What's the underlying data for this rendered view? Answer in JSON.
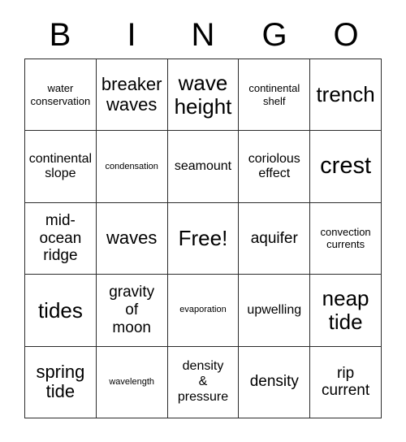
{
  "card": {
    "title": "BINGO",
    "header_letters": [
      "B",
      "I",
      "N",
      "G",
      "O"
    ],
    "columns": 5,
    "rows": 5,
    "free_space": "Free!",
    "free_space_position": {
      "row": 3,
      "column": 3
    },
    "colors": {
      "background": "#ffffff",
      "cell_background": "#ffffff",
      "border": "#2b2b2b",
      "text": "#000000"
    },
    "cells": [
      [
        {
          "text": "water\nconservation",
          "size": "sz-sm"
        },
        {
          "text": "breaker\nwaves",
          "size": "sz-xl"
        },
        {
          "text": "wave\nheight",
          "size": "sz-2xl"
        },
        {
          "text": "continental\nshelf",
          "size": "sz-sm"
        },
        {
          "text": "trench",
          "size": "sz-2xl"
        }
      ],
      [
        {
          "text": "continental\nslope",
          "size": "sz-md"
        },
        {
          "text": "condensation",
          "size": "sz-xs"
        },
        {
          "text": "seamount",
          "size": "sz-md"
        },
        {
          "text": "coriolous\neffect",
          "size": "sz-md"
        },
        {
          "text": "crest",
          "size": "sz-3xl"
        }
      ],
      [
        {
          "text": "mid-\nocean\nridge",
          "size": "sz-lg"
        },
        {
          "text": "waves",
          "size": "sz-xl"
        },
        {
          "text": "Free!",
          "size": "sz-2xl"
        },
        {
          "text": "aquifer",
          "size": "sz-lg"
        },
        {
          "text": "convection\ncurrents",
          "size": "sz-sm"
        }
      ],
      [
        {
          "text": "tides",
          "size": "sz-2xl"
        },
        {
          "text": "gravity\nof\nmoon",
          "size": "sz-lg"
        },
        {
          "text": "evaporation",
          "size": "sz-xs"
        },
        {
          "text": "upwelling",
          "size": "sz-md"
        },
        {
          "text": "neap\ntide",
          "size": "sz-2xl"
        }
      ],
      [
        {
          "text": "spring\ntide",
          "size": "sz-xl"
        },
        {
          "text": "wavelength",
          "size": "sz-xs"
        },
        {
          "text": "density\n&\npressure",
          "size": "sz-md"
        },
        {
          "text": "density",
          "size": "sz-lg"
        },
        {
          "text": "rip\ncurrent",
          "size": "sz-lg"
        }
      ]
    ]
  }
}
